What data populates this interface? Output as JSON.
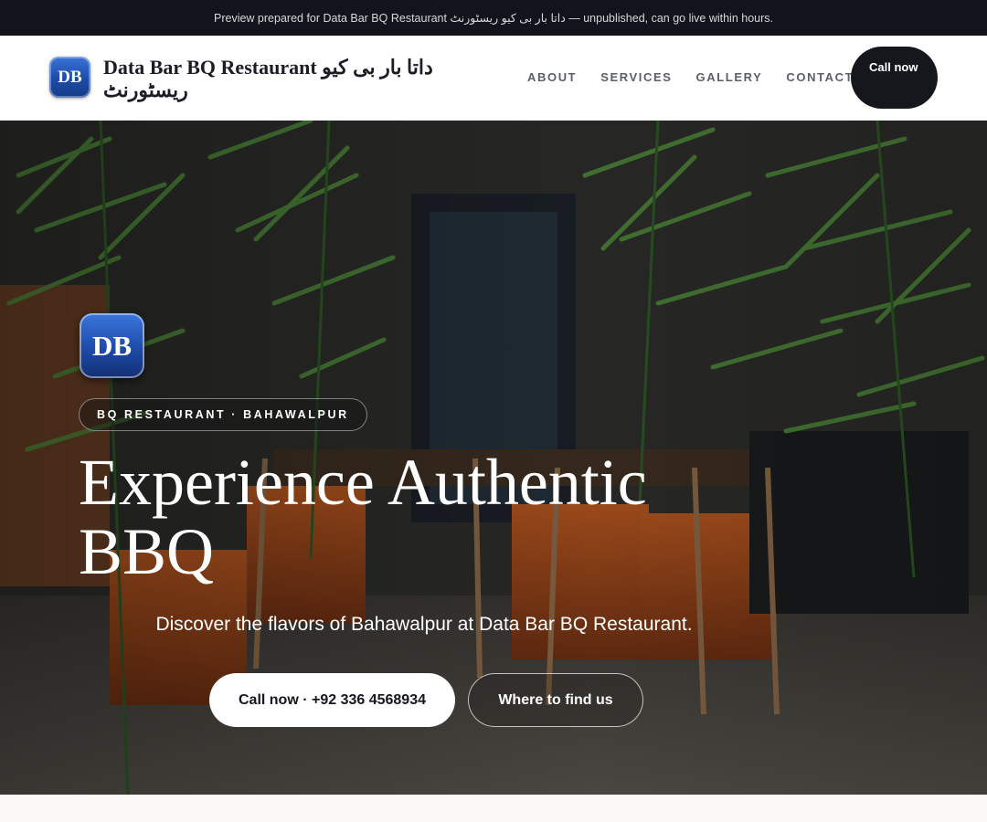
{
  "banner": {
    "text": "Preview prepared for Data Bar BQ Restaurant داتا بار بی کیو ریسٹورنٹ — unpublished, can go live within hours."
  },
  "header": {
    "logo_text": "DB",
    "brand_name": "Data Bar BQ Restaurant داتا بار بی کیو ریسٹورنٹ",
    "nav": [
      {
        "label": "ABOUT"
      },
      {
        "label": "SERVICES"
      },
      {
        "label": "GALLERY"
      },
      {
        "label": "CONTACT"
      }
    ],
    "cta_label": "Call now"
  },
  "hero": {
    "logo_text": "DB",
    "eyebrow": "BQ RESTAURANT · BAHAWALPUR",
    "title": "Experience Authentic BBQ",
    "subtitle": "Discover the flavors of Bahawalpur at Data Bar BQ Restaurant.",
    "primary_button": "Call now · +92 336 4568934",
    "secondary_button": "Where to find us"
  },
  "colors": {
    "banner_bg": "#11141b",
    "dark_button": "#15171d",
    "logo_blue": "#1d4ba8",
    "page_bg": "#faf9f6"
  }
}
